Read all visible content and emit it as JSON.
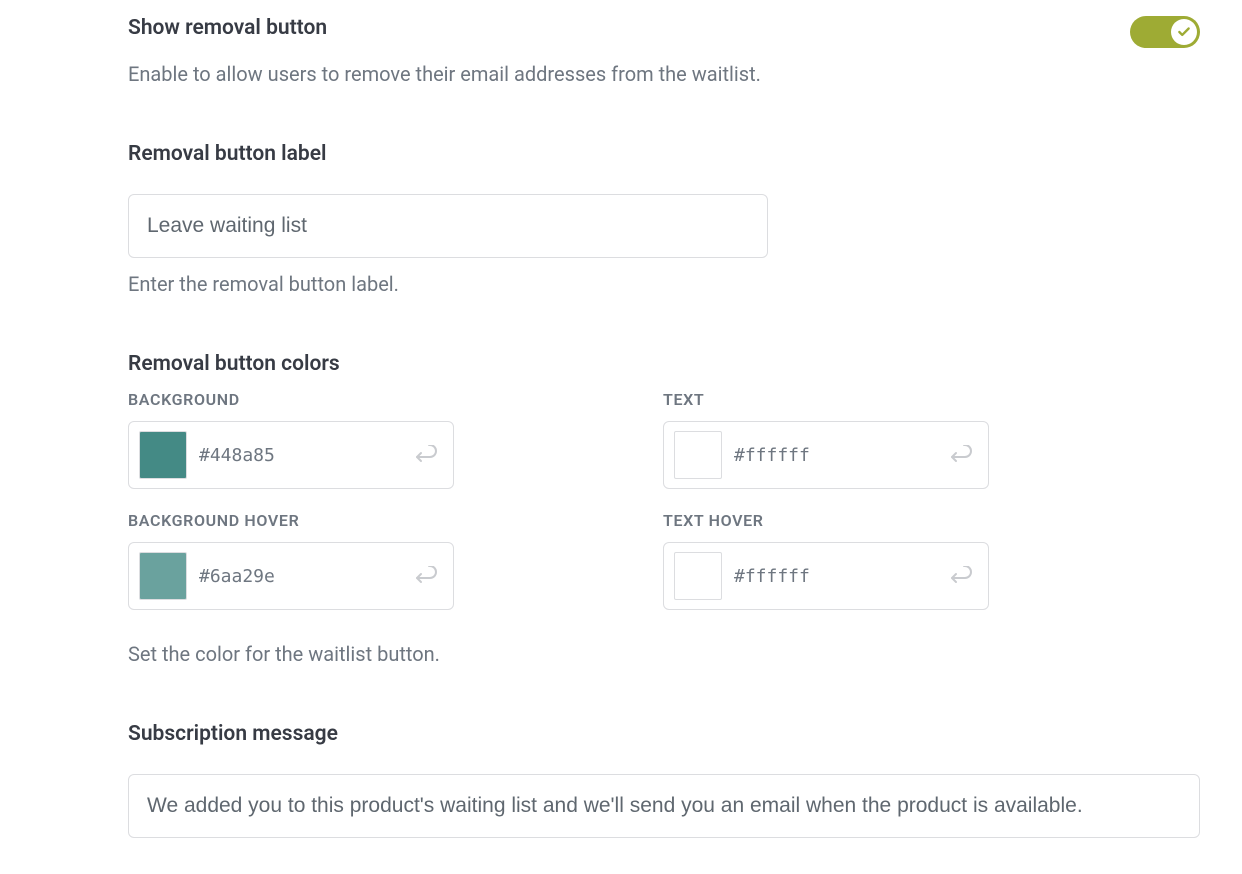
{
  "show_removal": {
    "title": "Show removal button",
    "help": "Enable to allow users to remove their email addresses from the waitlist.",
    "enabled": true
  },
  "removal_label": {
    "title": "Removal button label",
    "value": "Leave waiting list",
    "help": "Enter the removal button label."
  },
  "removal_colors": {
    "title": "Removal button colors",
    "background": {
      "label": "BACKGROUND",
      "hex": "#448a85"
    },
    "background_hover": {
      "label": "BACKGROUND HOVER",
      "hex": "#6aa29e"
    },
    "text": {
      "label": "TEXT",
      "hex": "#ffffff"
    },
    "text_hover": {
      "label": "TEXT HOVER",
      "hex": "#ffffff"
    },
    "help": "Set the color for the waitlist button."
  },
  "subscription_message": {
    "title": "Subscription message",
    "value": "We added you to this product's waiting list and we'll send you an email when the product is available."
  }
}
